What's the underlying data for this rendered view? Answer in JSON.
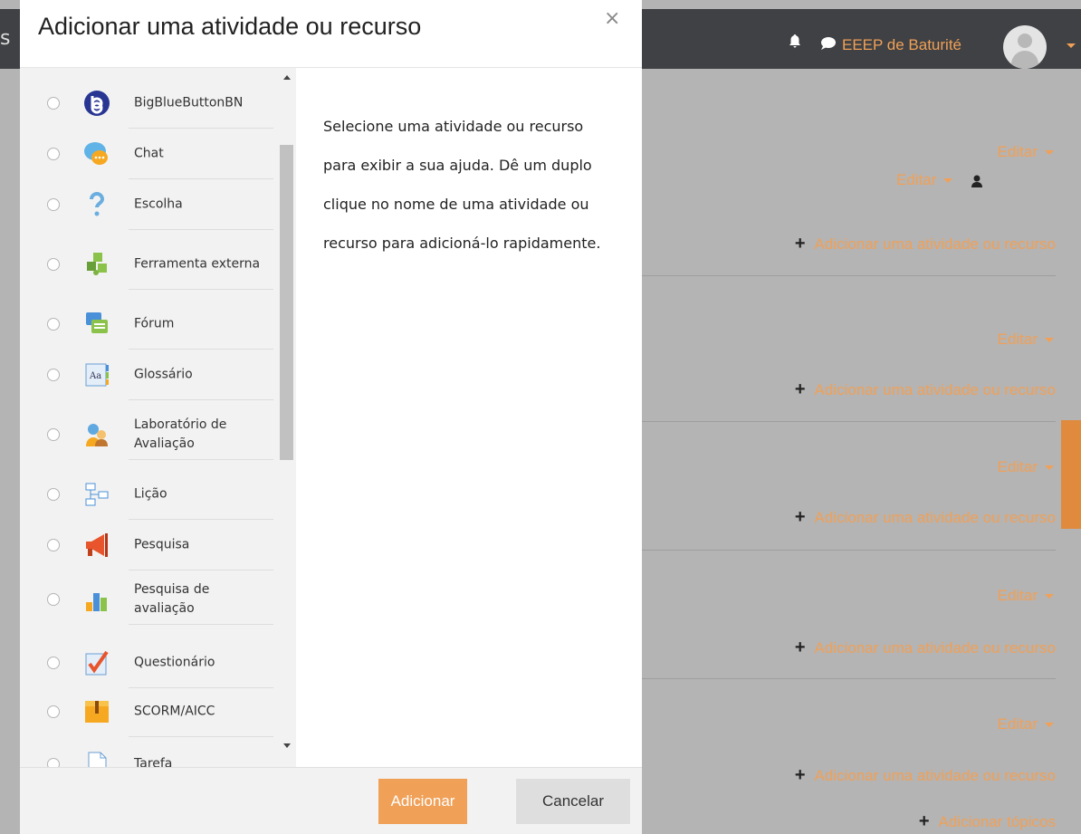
{
  "header": {
    "username": "EEEP de Baturité"
  },
  "course": {
    "edit_label": "Editar",
    "add_activity_label": "Adicionar uma atividade ou recurso",
    "add_topics_label": "Adicionar tópicos"
  },
  "modal": {
    "title": "Adicionar uma atividade ou recurso",
    "close_glyph": "×",
    "help_text": "Selecione uma atividade ou recurso para exibir a sua ajuda. Dê um duplo clique no nome de uma atividade ou recurso para adicioná-lo rapidamente.",
    "items": [
      {
        "label": "BigBlueButtonBN",
        "icon": "bigbluebutton-icon"
      },
      {
        "label": "Chat",
        "icon": "chat-icon"
      },
      {
        "label": "Escolha",
        "icon": "question-icon"
      },
      {
        "label": "Ferramenta externa",
        "icon": "puzzle-icon"
      },
      {
        "label": "Fórum",
        "icon": "forum-icon"
      },
      {
        "label": "Glossário",
        "icon": "glossary-icon"
      },
      {
        "label": "Laboratório de Avaliação",
        "icon": "workshop-icon"
      },
      {
        "label": "Lição",
        "icon": "lesson-icon"
      },
      {
        "label": "Pesquisa",
        "icon": "megaphone-icon"
      },
      {
        "label": "Pesquisa de avaliação",
        "icon": "bar-chart-icon"
      },
      {
        "label": "Questionário",
        "icon": "quiz-icon"
      },
      {
        "label": "SCORM/AICC",
        "icon": "scorm-icon"
      },
      {
        "label": "Tarefa",
        "icon": "assignment-icon"
      }
    ],
    "buttons": {
      "add": "Adicionar",
      "cancel": "Cancelar"
    }
  },
  "colors": {
    "accent": "#f0a057",
    "navbar": "#3f4144"
  }
}
